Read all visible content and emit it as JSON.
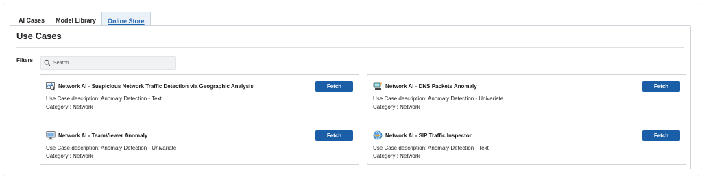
{
  "tabs": [
    {
      "label": "AI Cases"
    },
    {
      "label": "Model Library"
    },
    {
      "label": "Online Store"
    }
  ],
  "panel": {
    "title": "Use Cases",
    "filters_label": "Filters",
    "search_placeholder": "Search..."
  },
  "fetch_label": "Fetch",
  "cards": [
    {
      "icon": "chart-magnifier-icon",
      "title": "Network AI - Suspicious Network Traffic Detection via Geographic Analysis",
      "desc_label": "Use Case description:",
      "desc_value": "Anomaly Detection - Text",
      "cat_label": "Category :",
      "cat_value": "Network"
    },
    {
      "icon": "server-network-icon",
      "title": "Network AI - DNS Packets Anomaly",
      "desc_label": "Use Case description:",
      "desc_value": "Anomaly Detection - Univariate",
      "cat_label": "Category :",
      "cat_value": "Network"
    },
    {
      "icon": "monitor-icon",
      "title": "Network AI - TeamViewer Anomaly",
      "desc_label": "Use Case description:",
      "desc_value": "Anomaly Detection - Univariate",
      "cat_label": "Category :",
      "cat_value": "Network"
    },
    {
      "icon": "globe-network-icon",
      "title": "Network AI - SIP Traffic Inspector",
      "desc_label": "Use Case description:",
      "desc_value": "Anomaly Detection - Text",
      "cat_label": "Category :",
      "cat_value": "Network"
    }
  ],
  "colors": {
    "accent": "#1b5ea8",
    "active_tab_text": "#1f64b0"
  }
}
